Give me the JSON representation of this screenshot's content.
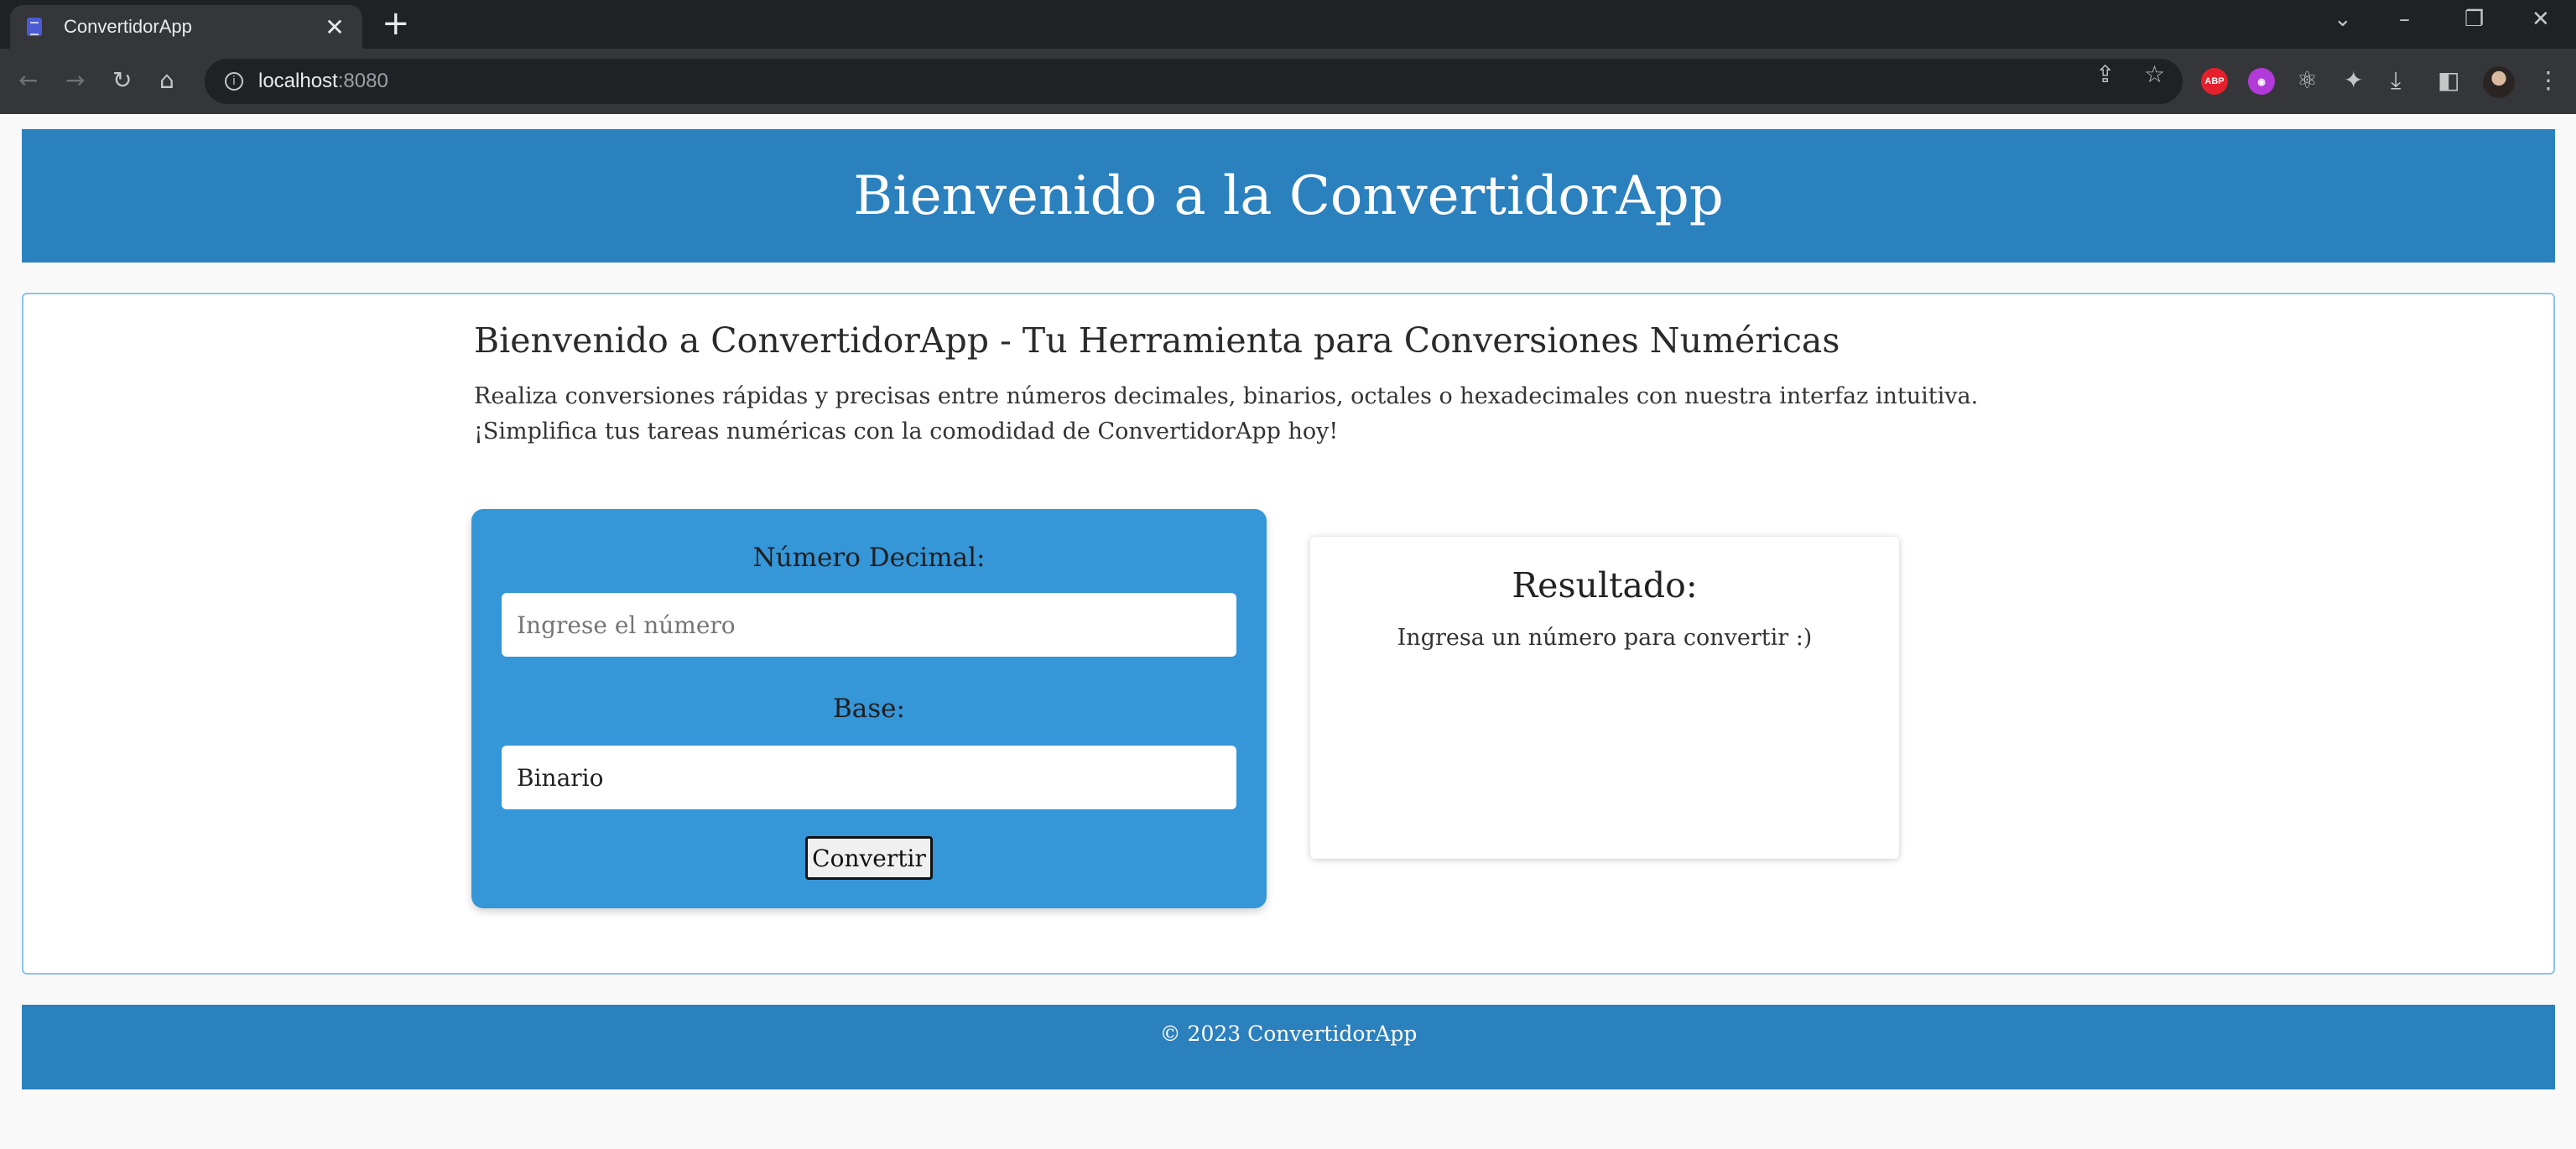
{
  "browser": {
    "tab_title": "ConvertidorApp",
    "tab_close": "✕",
    "new_tab": "+",
    "url_host": "localhost",
    "url_port": ":8080",
    "extensions": [
      {
        "name": "adblock-plus",
        "label": "ABP",
        "color": "#e4202c"
      },
      {
        "name": "vpn-extension",
        "label": "",
        "color": "#b23ad8"
      }
    ]
  },
  "header": {
    "title": "Bienvenido a la ConvertidorApp"
  },
  "intro": {
    "title": "Bienvenido a ConvertidorApp - Tu Herramienta para Conversiones Numéricas",
    "text": "Realiza conversiones rápidas y precisas entre números decimales, binarios, octales o hexadecimales con nuestra interfaz intuitiva. ¡Simplifica tus tareas numéricas con la comodidad de ConvertidorApp hoy!"
  },
  "form": {
    "number_label": "Número Decimal:",
    "number_placeholder": "Ingrese el número",
    "number_value": "",
    "base_label": "Base:",
    "base_selected": "Binario",
    "submit_label": "Convertir"
  },
  "result": {
    "title": "Resultado:",
    "message": "Ingresa un número para convertir :)"
  },
  "footer": {
    "text": "© 2023 ConvertidorApp"
  },
  "colors": {
    "header_bg": "#2b80be",
    "form_bg": "#3596d8",
    "card_border": "#8cc3e8"
  }
}
